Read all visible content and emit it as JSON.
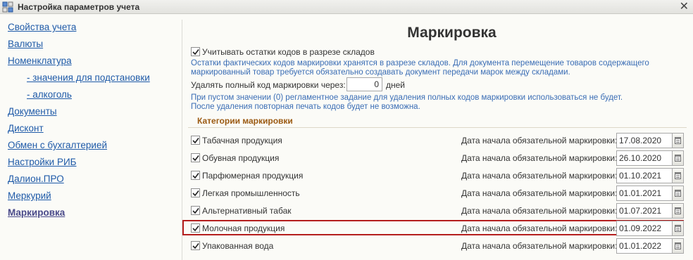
{
  "window": {
    "title": "Настройка параметров учета",
    "close_glyph": "✕"
  },
  "sidebar": {
    "items": [
      {
        "label": "Свойства учета"
      },
      {
        "label": "Валюты"
      },
      {
        "label": "Номенклатура"
      },
      {
        "label": "- значения для подстановки"
      },
      {
        "label": "- алкоголь"
      },
      {
        "label": "Документы"
      },
      {
        "label": "Дисконт"
      },
      {
        "label": "Обмен с бухгалтерией"
      },
      {
        "label": "Настройки РИБ"
      },
      {
        "label": "Далион.ПРО"
      },
      {
        "label": "Меркурий"
      },
      {
        "label": "Маркировка"
      }
    ],
    "active": "Маркировка"
  },
  "main": {
    "title": "Маркировка",
    "warehouse_checkbox": {
      "label": "Учитывать остатки кодов в разрезе складов",
      "checked": true
    },
    "warehouse_hint": [
      "Остатки фактических кодов маркировки хранятся в разрезе складов. Для документа перемещение товаров содержащего",
      "маркированный товар требуется обязательно создавать документ передачи марок между складами."
    ],
    "delete_label": "Удалять полный код маркировки через:",
    "delete_value": "0",
    "delete_unit": "дней",
    "delete_hint": [
      "При пустом значении (0) регламентное задание для удаления полных кодов маркировки использоваться не будет.",
      "После удаления повторная печать кодов будет не возможна."
    ],
    "categories_title": "Категории маркировки",
    "date_label": "Дата начала обязательной маркировки:",
    "categories": [
      {
        "label": "Табачная продукция",
        "checked": true,
        "date": "17.08.2020"
      },
      {
        "label": "Обувная продукция",
        "checked": true,
        "date": "26.10.2020"
      },
      {
        "label": "Парфюмерная продукция",
        "checked": true,
        "date": "01.10.2021"
      },
      {
        "label": "Легкая промышленность",
        "checked": true,
        "date": "01.01.2021"
      },
      {
        "label": "Альтернативный табак",
        "checked": true,
        "date": "01.07.2021"
      },
      {
        "label": "Молочная продукция",
        "checked": true,
        "date": "01.09.2022"
      },
      {
        "label": "Упакованная вода",
        "checked": true,
        "date": "01.01.2022"
      }
    ],
    "highlighted_category": "Молочная продукция"
  },
  "colors": {
    "link": "#1e5aa8",
    "hint": "#3a6db5",
    "group_title": "#9b5a12",
    "highlight_border": "#b51e1e"
  },
  "icons": {
    "app": "settings-grid-icon",
    "checkbox": "checkmark-icon",
    "date_picker": "calendar-icon"
  }
}
